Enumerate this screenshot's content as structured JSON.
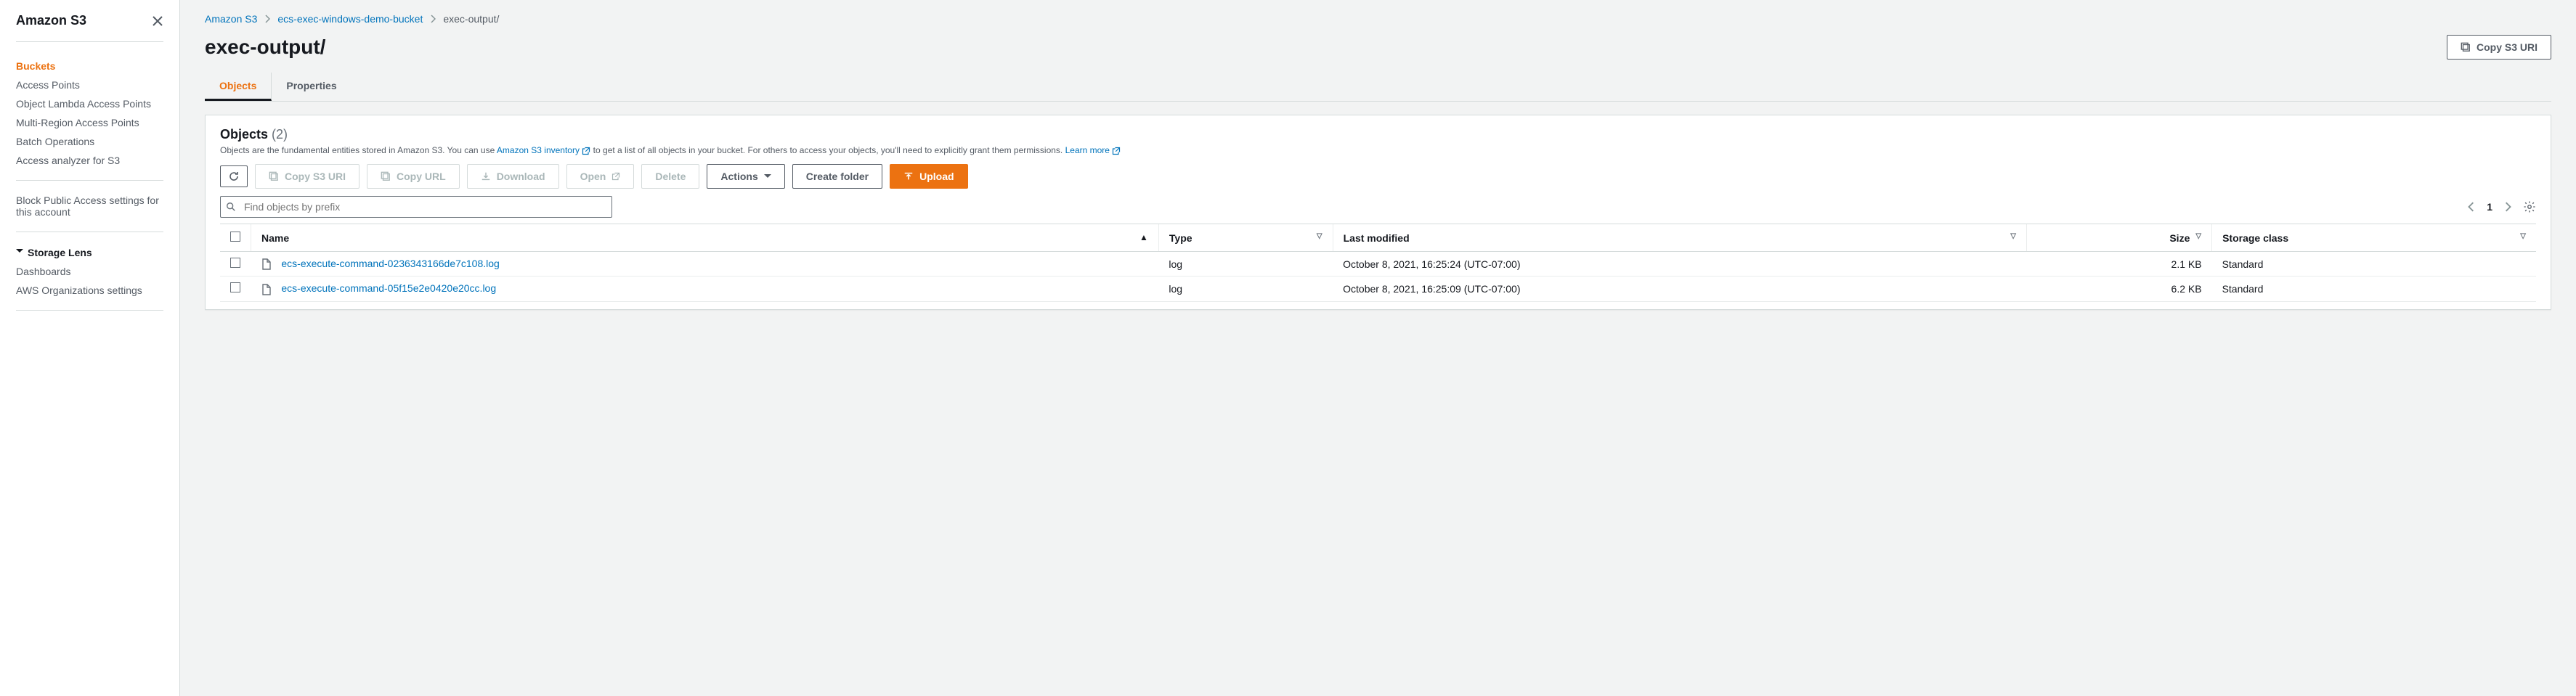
{
  "sidebar": {
    "title": "Amazon S3",
    "items": [
      {
        "label": "Buckets",
        "active": true
      },
      {
        "label": "Access Points"
      },
      {
        "label": "Object Lambda Access Points"
      },
      {
        "label": "Multi-Region Access Points"
      },
      {
        "label": "Batch Operations"
      },
      {
        "label": "Access analyzer for S3"
      }
    ],
    "block_public": "Block Public Access settings for this account",
    "storage_lens": {
      "label": "Storage Lens",
      "items": [
        {
          "label": "Dashboards"
        },
        {
          "label": "AWS Organizations settings"
        }
      ]
    }
  },
  "breadcrumbs": {
    "root": "Amazon S3",
    "bucket": "ecs-exec-windows-demo-bucket",
    "current": "exec-output/"
  },
  "page": {
    "title": "exec-output/",
    "copy_uri": "Copy S3 URI"
  },
  "tabs": {
    "objects": "Objects",
    "properties": "Properties"
  },
  "panel": {
    "title": "Objects",
    "count": "(2)",
    "desc_pre": "Objects are the fundamental entities stored in Amazon S3. You can use ",
    "desc_link1": "Amazon S3 inventory",
    "desc_mid": " to get a list of all objects in your bucket. For others to access your objects, you'll need to explicitly grant them permissions. ",
    "desc_link2": "Learn more"
  },
  "toolbar": {
    "copy_uri": "Copy S3 URI",
    "copy_url": "Copy URL",
    "download": "Download",
    "open": "Open",
    "delete": "Delete",
    "actions": "Actions",
    "create_folder": "Create folder",
    "upload": "Upload"
  },
  "search": {
    "placeholder": "Find objects by prefix"
  },
  "pager": {
    "page": "1"
  },
  "table": {
    "headers": {
      "name": "Name",
      "type": "Type",
      "last_modified": "Last modified",
      "size": "Size",
      "storage_class": "Storage class"
    },
    "rows": [
      {
        "name": "ecs-execute-command-0236343166de7c108.log",
        "type": "log",
        "modified": "October 8, 2021, 16:25:24 (UTC-07:00)",
        "size": "2.1 KB",
        "storage": "Standard"
      },
      {
        "name": "ecs-execute-command-05f15e2e0420e20cc.log",
        "type": "log",
        "modified": "October 8, 2021, 16:25:09 (UTC-07:00)",
        "size": "6.2 KB",
        "storage": "Standard"
      }
    ]
  }
}
